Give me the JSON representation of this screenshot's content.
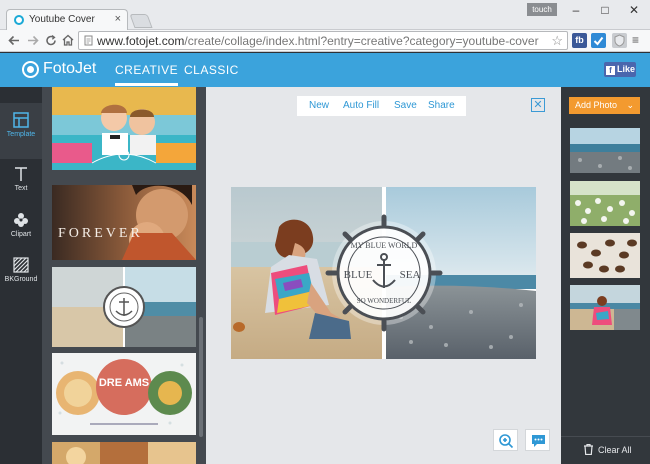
{
  "browser": {
    "tab_title": "Youtube Cover",
    "tab_close": "×",
    "touch_badge": "touch",
    "url_host": "www.fotojet.com",
    "url_path": "/create/collage/index.html?entry=creative?category=youtube-cover",
    "win_minimize": "–",
    "win_maximize": "□",
    "win_close": "✕",
    "ext_fb": "fb",
    "menu_glyph": "≡",
    "star_glyph": "☆"
  },
  "app": {
    "logo": "FotoJet",
    "nav": [
      "CREATIVE",
      "CLASSIC"
    ],
    "like_label": "Like",
    "accent": "#3ba3dc"
  },
  "sidebar": {
    "items": [
      {
        "label": "Template",
        "icon": "template-icon"
      },
      {
        "label": "Text",
        "icon": "text-icon"
      },
      {
        "label": "Clipart",
        "icon": "clipart-icon"
      },
      {
        "label": "BKGround",
        "icon": "background-icon"
      }
    ]
  },
  "templates": {
    "forever_text": "FOREVER",
    "dreams_text": "DRE AMS"
  },
  "canvas": {
    "actions": [
      "New",
      "Auto Fill",
      "Save",
      "Share"
    ],
    "close_glyph": "✕",
    "badge_top": "MY BLUE WORLD",
    "badge_left": "BLUE",
    "badge_right": "SEA",
    "badge_bottom": "SO WONDERFUL"
  },
  "right": {
    "add_photo": "Add Photo",
    "add_photo_chevron": "⌄",
    "clear_all": "Clear All",
    "orange": "#f39a2f"
  }
}
